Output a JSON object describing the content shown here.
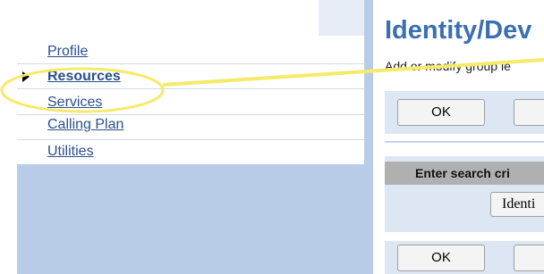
{
  "sidebar": {
    "items": [
      {
        "label": "Profile",
        "active": false
      },
      {
        "label": "Resources",
        "active": true
      },
      {
        "label": "Services",
        "active": false
      },
      {
        "label": "Calling Plan",
        "active": false
      },
      {
        "label": "Utilities",
        "active": false
      }
    ]
  },
  "main": {
    "title": "Identity/Dev",
    "subtitle": "Add or modify group le",
    "top_buttons": [
      "OK",
      ""
    ],
    "search_header": "Enter search cri",
    "search_field_button": "Identi",
    "bottom_buttons": [
      "OK",
      ""
    ]
  },
  "colors": {
    "link": "#2a4f8e",
    "title": "#3b6fb0",
    "highlight": "#f5ea6a",
    "sidebar_bg": "#b8cce8",
    "panel_bg": "#dde7f4"
  }
}
